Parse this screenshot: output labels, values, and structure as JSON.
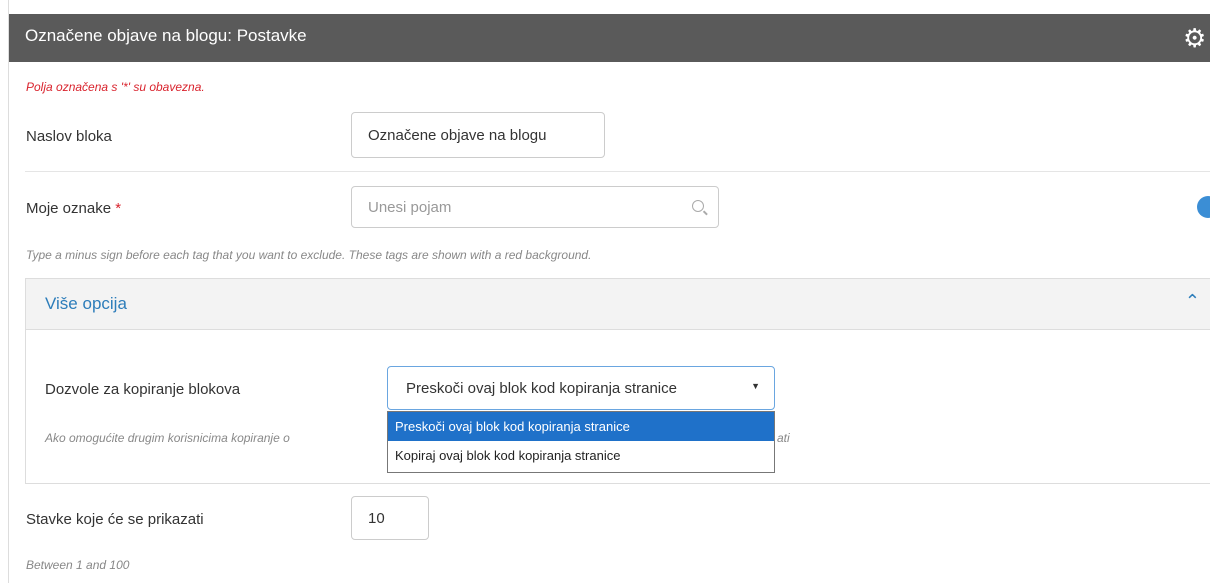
{
  "header": {
    "title": "Označene objave na blogu: Postavke",
    "gear_icon": "gear-icon"
  },
  "required_note": "Polja označena s '*' su obavezna.",
  "block_title": {
    "label": "Naslov bloka",
    "value": "Označene objave na blogu"
  },
  "tags": {
    "label": "Moje oznake",
    "required_mark": "*",
    "placeholder": "Unesi pojam",
    "help": "Type a minus sign before each tag that you want to exclude. These tags are shown with a red background."
  },
  "more_options": {
    "title": "Više opcija",
    "chevron": "chevron-up-icon",
    "copy_permissions": {
      "label": "Dozvole za kopiranje blokova",
      "selected": "Preskoči ovaj blok kod kopiranja stranice",
      "options": [
        "Preskoči ovaj blok kod kopiranja stranice",
        "Kopiraj ovaj blok kod kopiranja stranice"
      ],
      "help_left": "Ako omogućite drugim korisnicima kopiranje o",
      "help_right": "ati"
    }
  },
  "items": {
    "label": "Stavke koje će se prikazati",
    "value": "10",
    "help": "Between 1 and 100"
  },
  "colors": {
    "header_bg": "#5a5a5a",
    "accent": "#2d7dba",
    "required": "#d9232d",
    "selected_option": "#1f71c9"
  }
}
